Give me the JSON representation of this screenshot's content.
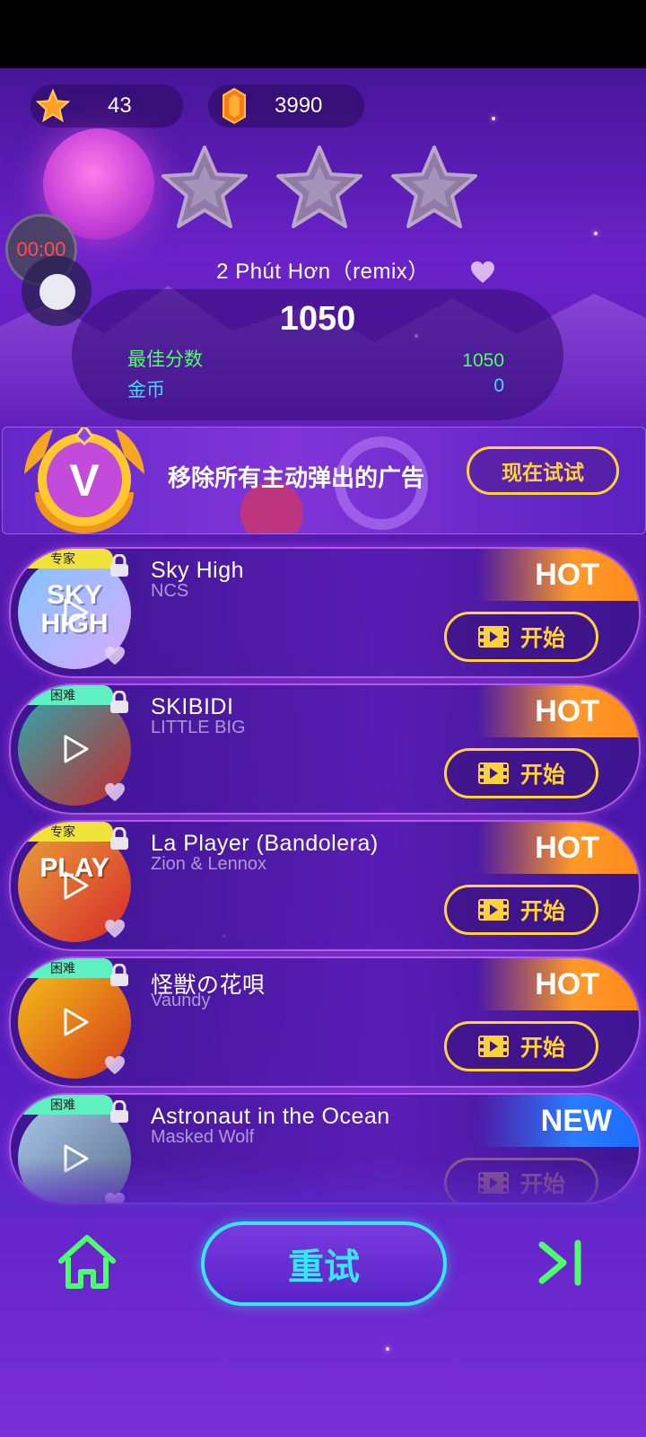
{
  "hud": {
    "stars_count": "43",
    "gems_count": "3990",
    "timer": "00:00"
  },
  "result": {
    "song_title": "2 Phút Hơn（remix）",
    "score": "1050",
    "best_score_label": "最佳分数",
    "best_score_value": "1050",
    "coins_label": "金币",
    "coins_value": "0",
    "stars_earned_of_3": 0
  },
  "vip_banner": {
    "badge_letter": "V",
    "text": "移除所有主动弹出的广告",
    "button": "现在试试"
  },
  "songs": [
    {
      "name": "Sky High",
      "artist": "NCS",
      "difficulty": "专家",
      "tag": "HOT",
      "button": "开始",
      "cover_text": "SKY HIGH",
      "cover_colors": [
        "#7fc6ff",
        "#d9a8ff"
      ]
    },
    {
      "name": "SKIBIDI",
      "artist": "LITTLE BIG",
      "difficulty": "困难",
      "tag": "HOT",
      "button": "开始",
      "cover_text": "",
      "cover_colors": [
        "#2aa9b0",
        "#c82828"
      ]
    },
    {
      "name": "La Player (Bandolera)",
      "artist": "Zion & Lennox",
      "difficulty": "专家",
      "tag": "HOT",
      "button": "开始",
      "cover_text": "PLAY",
      "cover_colors": [
        "#e8a238",
        "#d8282a"
      ]
    },
    {
      "name": "怪獣の花唄",
      "artist": "Vaundy",
      "difficulty": "困难",
      "tag": "HOT",
      "button": "开始",
      "cover_text": "",
      "cover_colors": [
        "#f4c21a",
        "#d63a1a"
      ]
    },
    {
      "name": "Astronaut in the Ocean",
      "artist": "Masked Wolf",
      "difficulty": "困难",
      "tag": "NEW",
      "button": "开始",
      "cover_text": "",
      "cover_colors": [
        "#a8c8e8",
        "#5a6a8a"
      ]
    }
  ],
  "bottom_bar": {
    "retry": "重试"
  },
  "colors": {
    "accent_yellow": "#ffd23a",
    "accent_cyan": "#35e8ff",
    "green": "#4dff6a",
    "hot_orange": "#ff9a2a",
    "new_blue": "#2c7cff"
  }
}
